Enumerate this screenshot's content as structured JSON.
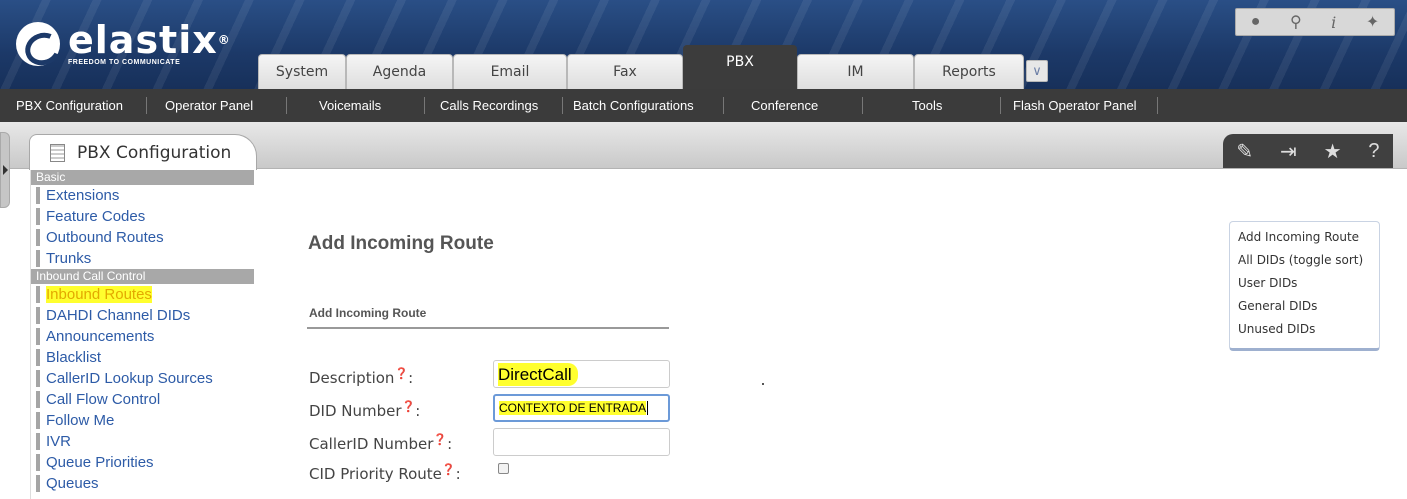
{
  "logo": {
    "name": "elastix",
    "tagline": "FREEDOM TO COMMUNICATE"
  },
  "main_tabs": [
    "System",
    "Agenda",
    "Email",
    "Fax",
    "PBX",
    "IM",
    "Reports"
  ],
  "active_tab": "PBX",
  "subnav": [
    "PBX Configuration",
    "Operator Panel",
    "Voicemails",
    "Calls Recordings",
    "Batch Configurations",
    "Conference",
    "Tools",
    "Flash Operator Panel"
  ],
  "module": {
    "title": "PBX Configuration"
  },
  "sidebar": {
    "sections": [
      {
        "header": "Basic",
        "items": [
          "Extensions",
          "Feature Codes",
          "Outbound Routes",
          "Trunks"
        ]
      },
      {
        "header": "Inbound Call Control",
        "items": [
          "Inbound Routes",
          "DAHDI Channel DIDs",
          "Announcements",
          "Blacklist",
          "CallerID Lookup Sources",
          "Call Flow Control",
          "Follow Me",
          "IVR",
          "Queue Priorities",
          "Queues"
        ]
      }
    ],
    "highlighted": "Inbound Routes"
  },
  "page": {
    "title": "Add Incoming Route",
    "section": "Add Incoming Route"
  },
  "form": {
    "description_label": "Description",
    "description_value": "DirectCall",
    "did_label": "DID Number",
    "did_value": "CONTEXTO DE ENTRADA",
    "callerid_label": "CallerID Number",
    "callerid_value": "",
    "cid_priority_label": "CID Priority Route",
    "cid_priority_checked": false
  },
  "right_menu": [
    "Add Incoming Route",
    "All DIDs (toggle sort)",
    "User DIDs",
    "General DIDs",
    "Unused DIDs"
  ],
  "colors": {
    "header": "#1c3968",
    "subnav": "#3b3b3b",
    "link": "#2d5ba7",
    "highlight": "#ffff2e"
  }
}
